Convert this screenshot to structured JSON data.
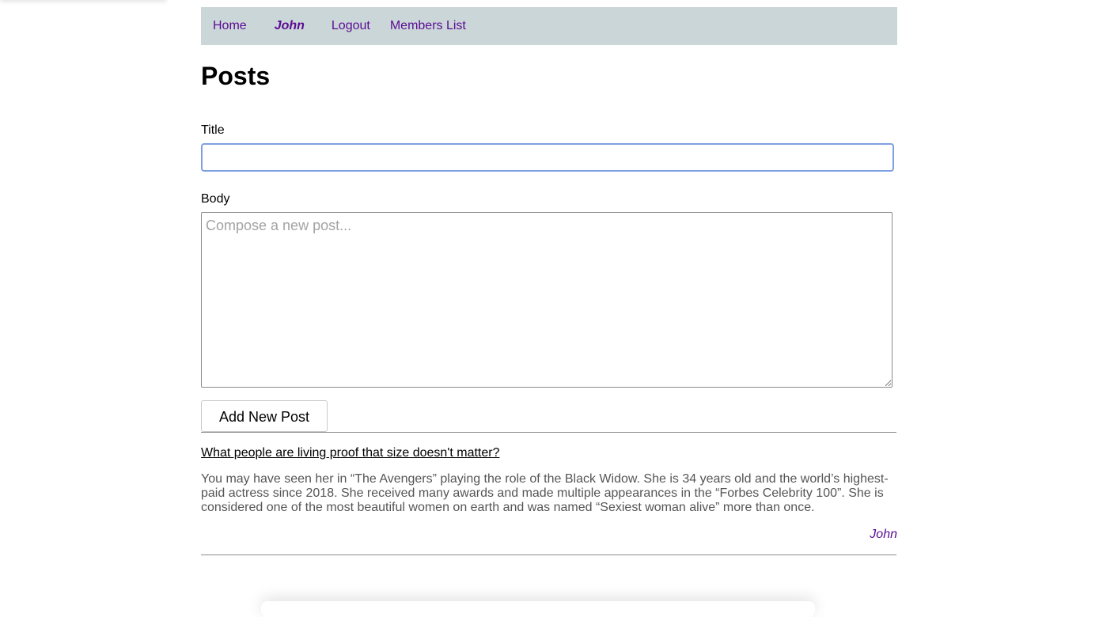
{
  "nav": {
    "home": "Home",
    "user": "John",
    "logout": "Logout",
    "members": "Members List"
  },
  "page_title": "Posts",
  "form": {
    "title_label": "Title",
    "title_value": "",
    "body_label": "Body",
    "body_placeholder": "Compose a new post...",
    "submit_label": "Add New Post"
  },
  "posts": [
    {
      "title": "What people are living proof that size doesn't matter?",
      "body": "You may have seen her in “The Avengers” playing the role of the Black Widow. She is 34 years old and the world’s highest-paid actress since 2018. She received many awards and made multiple appearances in the “Forbes Celebrity 100”. She is considered one of the most beautiful women on earth and was named “Sexiest woman alive” more than once.",
      "author": "John"
    }
  ],
  "colors": {
    "nav_background": "#cbd6d9",
    "link": "#5b0c93",
    "focus_border": "#7fa0e0"
  }
}
